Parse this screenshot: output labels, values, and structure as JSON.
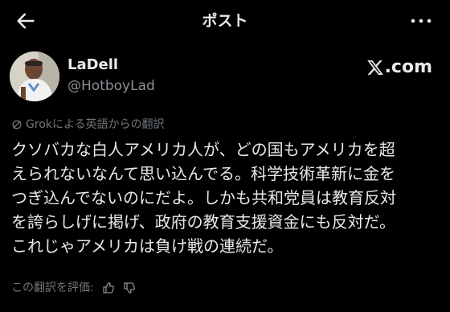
{
  "header": {
    "title": "ポスト"
  },
  "author": {
    "name": "LaDell",
    "handle": "@HotboyLad"
  },
  "watermark": {
    "text": ".com"
  },
  "translation": {
    "label": "Grokによる英語からの翻訳"
  },
  "tweet": {
    "lines": [
      "クソバカな白人アメリカ人が、どの国もアメリカを超",
      "えられないなんて思い込んでる。科学技術革新に金を",
      "つぎ込んでないのにだよ。しかも共和党員は教育反対",
      "を誇らしげに掲げ、政府の教育支援資金にも反対だ。",
      "これじゃアメリカは負け戦の連続だ。"
    ]
  },
  "rating": {
    "label": "この翻訳を評価:"
  },
  "colors": {
    "background": "#000000",
    "text_primary": "#e7e9ea",
    "text_secondary": "#71767b"
  },
  "icons": {
    "back": "arrow-left-icon",
    "more": "more-horizontal-icon",
    "grok": "grok-icon",
    "thumbs_up": "thumbs-up-icon",
    "thumbs_down": "thumbs-down-icon"
  }
}
